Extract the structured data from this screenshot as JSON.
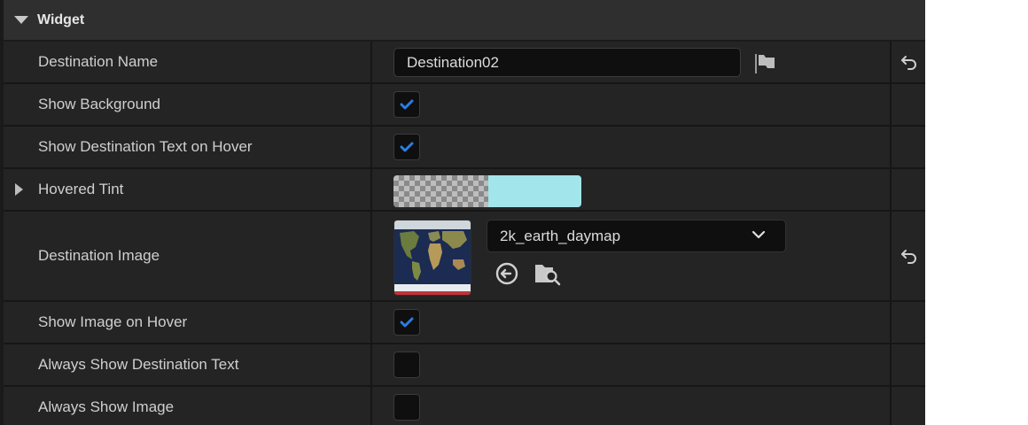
{
  "category": {
    "title": "Widget",
    "icon": "caret-down-icon"
  },
  "properties": {
    "destination_name": {
      "label": "Destination Name",
      "value": "Destination02",
      "has_reset": true
    },
    "show_background": {
      "label": "Show Background",
      "checked": true
    },
    "show_destination_text_on_hover": {
      "label": "Show Destination Text on Hover",
      "checked": true
    },
    "hovered_tint": {
      "label": "Hovered Tint",
      "color": "#a2e5ea"
    },
    "destination_image": {
      "label": "Destination Image",
      "asset": "2k_earth_daymap",
      "has_reset": true
    },
    "show_image_on_hover": {
      "label": "Show Image on Hover",
      "checked": true
    },
    "always_show_destination_text": {
      "label": "Always Show Destination Text",
      "checked": false
    },
    "always_show_image": {
      "label": "Always Show Image",
      "checked": false
    }
  },
  "colors": {
    "accent_check": "#2a7de1",
    "panel_bg": "#1a1a1a",
    "row_bg": "#242424",
    "header_bg": "#2f2f2f"
  }
}
